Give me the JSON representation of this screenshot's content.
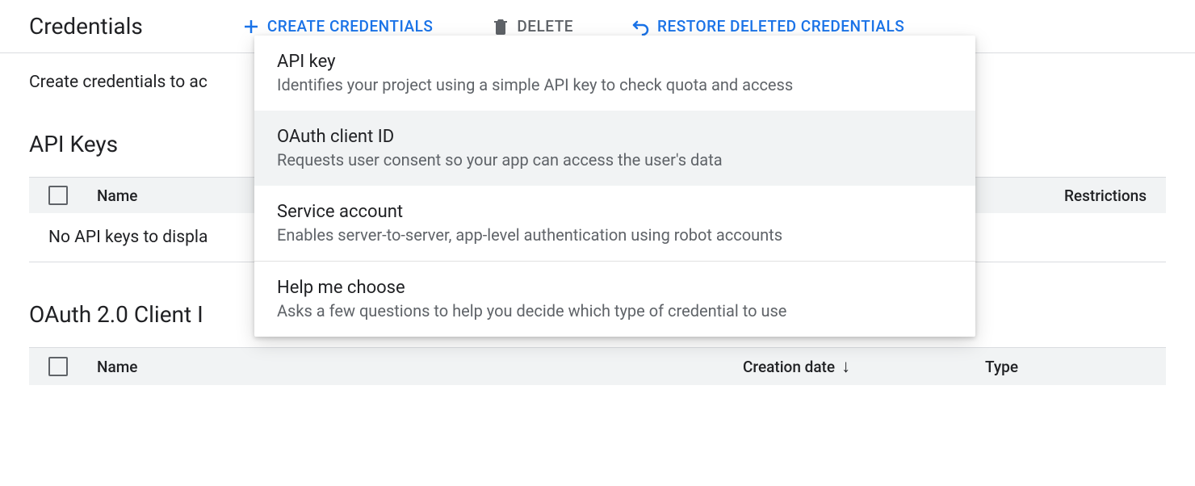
{
  "header": {
    "title": "Credentials",
    "create_label": "CREATE CREDENTIALS",
    "delete_label": "DELETE",
    "restore_label": "RESTORE DELETED CREDENTIALS"
  },
  "intro": "Create credentials to ac",
  "sections": {
    "api_keys": {
      "title": "API Keys",
      "columns": {
        "name": "Name",
        "restrictions": "Restrictions"
      },
      "empty": "No API keys to displa"
    },
    "oauth": {
      "title": "OAuth 2.0 Client I",
      "columns": {
        "name": "Name",
        "creation": "Creation date",
        "type": "Type"
      }
    }
  },
  "dropdown": {
    "items": [
      {
        "title": "API key",
        "desc": "Identifies your project using a simple API key to check quota and access"
      },
      {
        "title": "OAuth client ID",
        "desc": "Requests user consent so your app can access the user's data"
      },
      {
        "title": "Service account",
        "desc": "Enables server-to-server, app-level authentication using robot accounts"
      },
      {
        "title": "Help me choose",
        "desc": "Asks a few questions to help you decide which type of credential to use"
      }
    ]
  }
}
